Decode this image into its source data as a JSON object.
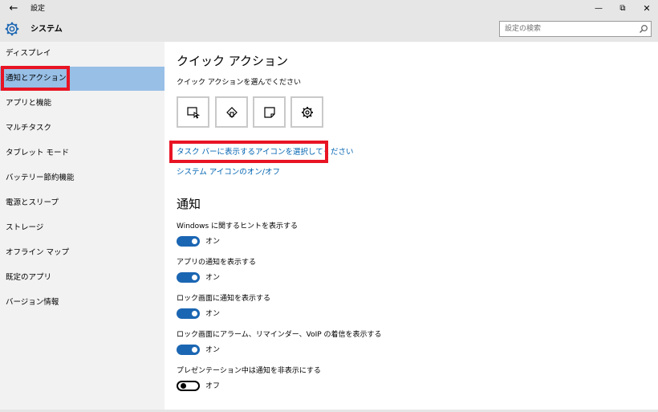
{
  "window": {
    "title": "設定",
    "back_icon": "←",
    "min_icon": "—",
    "max_icon": "⧉",
    "close_icon": "✕"
  },
  "header": {
    "title": "システム",
    "search_placeholder": "設定の検索"
  },
  "sidebar": {
    "items": [
      {
        "label": "ディスプレイ"
      },
      {
        "label": "通知とアクション",
        "active": true
      },
      {
        "label": "アプリと機能"
      },
      {
        "label": "マルチタスク"
      },
      {
        "label": "タブレット モード"
      },
      {
        "label": "バッテリー節約機能"
      },
      {
        "label": "電源とスリープ"
      },
      {
        "label": "ストレージ"
      },
      {
        "label": "オフライン マップ"
      },
      {
        "label": "既定のアプリ"
      },
      {
        "label": "バージョン情報"
      }
    ]
  },
  "quick_actions": {
    "title": "クイック アクション",
    "subtitle": "クイック アクションを選んでください",
    "buttons": [
      {
        "icon": "tablet-mode-icon"
      },
      {
        "icon": "location-icon"
      },
      {
        "icon": "note-icon"
      },
      {
        "icon": "settings-icon"
      }
    ],
    "link_taskbar_icons": "タスク バーに表示するアイコンを選択してください",
    "link_system_icons": "システム アイコンのオン/オフ"
  },
  "notifications": {
    "title": "通知",
    "settings": [
      {
        "label": "Windows に関するヒントを表示する",
        "state": "オン",
        "on": true
      },
      {
        "label": "アプリの通知を表示する",
        "state": "オン",
        "on": true
      },
      {
        "label": "ロック画面に通知を表示する",
        "state": "オン",
        "on": true
      },
      {
        "label": "ロック画面にアラーム、リマインダー、VoIP の着信を表示する",
        "state": "オン",
        "on": true
      },
      {
        "label": "プレゼンテーション中は通知を非表示にする",
        "state": "オフ",
        "on": false
      }
    ]
  },
  "colors": {
    "accent": "#1b66b3",
    "link": "#0063b1",
    "highlight": "#e81424",
    "active_nav": "#98bfe6"
  }
}
